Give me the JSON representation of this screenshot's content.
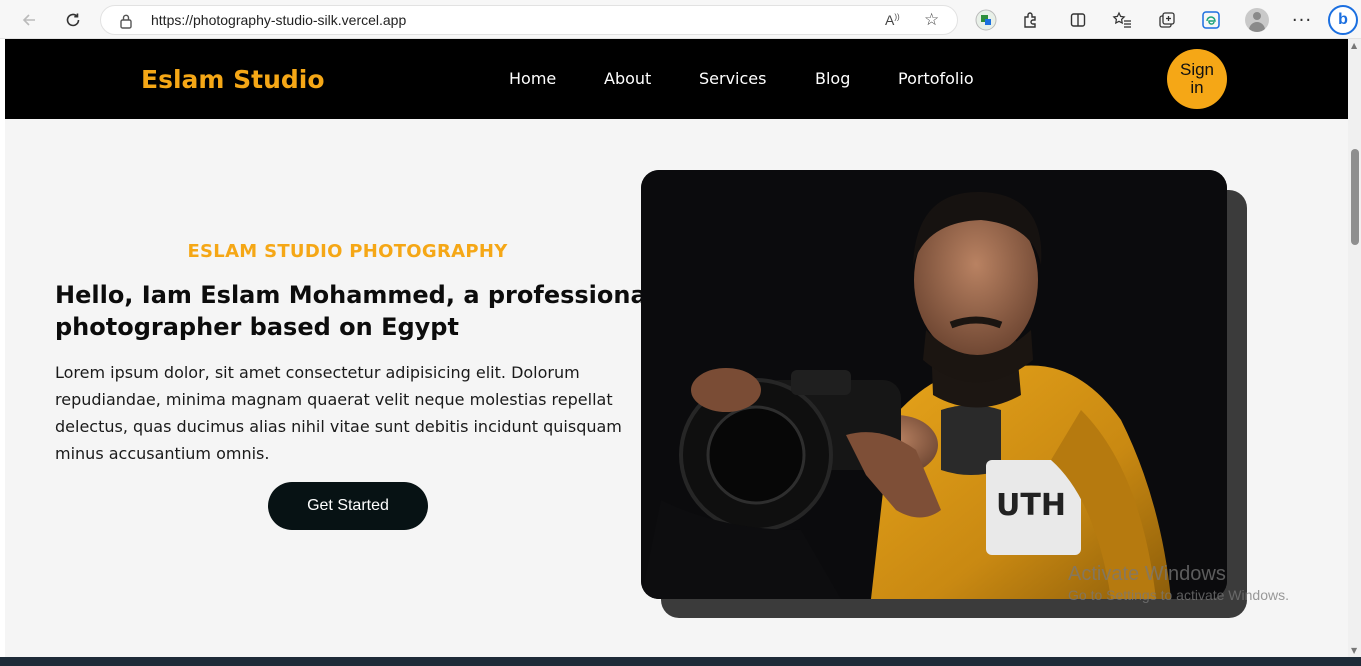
{
  "browser": {
    "url": "https://photography-studio-silk.vercel.app"
  },
  "header": {
    "brand": "Eslam Studio",
    "nav": [
      "Home",
      "About",
      "Services",
      "Blog",
      "Portofolio"
    ],
    "signin_label": "Sign in"
  },
  "hero": {
    "eyebrow": "ESLAM STUDIO PHOTOGRAPHY",
    "title": "Hello, Iam Eslam Mohammed, a professional photographer based on Egypt",
    "text": "Lorem ipsum dolor, sit amet consectetur adipisicing elit. Dolorum repudiandae, minima magnam quaerat velit neque molestias repellat delectus, quas ducimus alias nihil vitae sunt debitis incidunt quisquam minus accusantium omnis.",
    "cta_label": "Get Started"
  },
  "overlay": {
    "title": "Activate Windows",
    "subtitle": "Go to Settings to activate Windows."
  },
  "colors": {
    "accent": "#f5a716",
    "header_bg": "#000000",
    "cta_bg": "#071214"
  }
}
